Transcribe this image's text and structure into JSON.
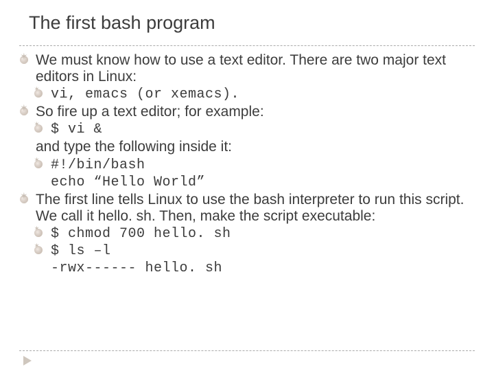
{
  "title": "The first bash program",
  "p1": "We must know how to use a text editor. There are two major text editors in Linux:",
  "p1s1": "vi, emacs (or xemacs).",
  "p2": "So fire up a text editor; for example:",
  "p2s1": "$ vi &",
  "p2c": "and type the following inside it:",
  "p2s2a": "#!/bin/bash",
  "p2s2b": "echo “Hello World”",
  "p3": "The first line tells Linux to use the bash interpreter to run this script. We call it hello. sh. Then, make the script executable:",
  "p3s1": "$ chmod 700 hello. sh",
  "p3s2": "$ ls –l",
  "p3s3": "-rwx------ hello. sh"
}
